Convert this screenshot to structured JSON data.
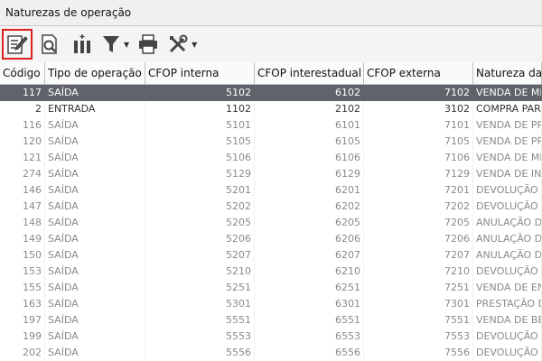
{
  "window": {
    "title": "Naturezas de operação"
  },
  "toolbar": {
    "buttons": [
      {
        "name": "edit-button",
        "icon": "edit-document-icon",
        "selected": true
      },
      {
        "name": "view-button",
        "icon": "magnify-document-icon"
      },
      {
        "name": "columns-button",
        "icon": "columns-icon"
      },
      {
        "name": "filter-button",
        "icon": "funnel-icon",
        "dropdown": true
      },
      {
        "name": "print-button",
        "icon": "printer-icon"
      },
      {
        "name": "tools-button",
        "icon": "tools-icon",
        "dropdown": true
      }
    ],
    "accent_selected": "#e02020"
  },
  "grid": {
    "columns": [
      "Código",
      "Tipo de operação",
      "CFOP interna",
      "CFOP interestadual",
      "CFOP externa",
      "Natureza da"
    ],
    "rows": [
      {
        "codigo": "117",
        "tipo": "SAÍDA",
        "interna": "5102",
        "inter": "6102",
        "externa": "7102",
        "natureza": "VENDA DE ME",
        "state": "selected"
      },
      {
        "codigo": "2",
        "tipo": "ENTRADA",
        "interna": "1102",
        "inter": "2102",
        "externa": "3102",
        "natureza": "COMPRA PAR",
        "state": "normal"
      },
      {
        "codigo": "116",
        "tipo": "SAÍDA",
        "interna": "5101",
        "inter": "6101",
        "externa": "7101",
        "natureza": "VENDA DE PR",
        "state": "dim"
      },
      {
        "codigo": "120",
        "tipo": "SAÍDA",
        "interna": "5105",
        "inter": "6105",
        "externa": "7105",
        "natureza": "VENDA DE PR",
        "state": "dim"
      },
      {
        "codigo": "121",
        "tipo": "SAÍDA",
        "interna": "5106",
        "inter": "6106",
        "externa": "7106",
        "natureza": "VENDA DE ME",
        "state": "dim"
      },
      {
        "codigo": "274",
        "tipo": "SAÍDA",
        "interna": "5129",
        "inter": "6129",
        "externa": "7129",
        "natureza": "VENDA DE INS",
        "state": "dim"
      },
      {
        "codigo": "146",
        "tipo": "SAÍDA",
        "interna": "5201",
        "inter": "6201",
        "externa": "7201",
        "natureza": "DEVOLUÇÃO",
        "state": "dim"
      },
      {
        "codigo": "147",
        "tipo": "SAÍDA",
        "interna": "5202",
        "inter": "6202",
        "externa": "7202",
        "natureza": "DEVOLUÇÃO",
        "state": "dim"
      },
      {
        "codigo": "148",
        "tipo": "SAÍDA",
        "interna": "5205",
        "inter": "6205",
        "externa": "7205",
        "natureza": "ANULAÇÃO D",
        "state": "dim"
      },
      {
        "codigo": "149",
        "tipo": "SAÍDA",
        "interna": "5206",
        "inter": "6206",
        "externa": "7206",
        "natureza": "ANULAÇÃO D",
        "state": "dim"
      },
      {
        "codigo": "150",
        "tipo": "SAÍDA",
        "interna": "5207",
        "inter": "6207",
        "externa": "7207",
        "natureza": "ANULAÇÃO D",
        "state": "dim"
      },
      {
        "codigo": "153",
        "tipo": "SAÍDA",
        "interna": "5210",
        "inter": "6210",
        "externa": "7210",
        "natureza": "DEVOLUÇÃO",
        "state": "dim"
      },
      {
        "codigo": "155",
        "tipo": "SAÍDA",
        "interna": "5251",
        "inter": "6251",
        "externa": "7251",
        "natureza": "VENDA DE EN",
        "state": "dim"
      },
      {
        "codigo": "163",
        "tipo": "SAÍDA",
        "interna": "5301",
        "inter": "6301",
        "externa": "7301",
        "natureza": "PRESTAÇÃO D",
        "state": "dim"
      },
      {
        "codigo": "197",
        "tipo": "SAÍDA",
        "interna": "5551",
        "inter": "6551",
        "externa": "7551",
        "natureza": "VENDA DE BE",
        "state": "dim"
      },
      {
        "codigo": "199",
        "tipo": "SAÍDA",
        "interna": "5553",
        "inter": "6553",
        "externa": "7553",
        "natureza": "DEVOLUÇÃO",
        "state": "dim"
      },
      {
        "codigo": "202",
        "tipo": "SAÍDA",
        "interna": "5556",
        "inter": "6556",
        "externa": "7556",
        "natureza": "DEVOLUÇÃO",
        "state": "dim"
      }
    ]
  }
}
